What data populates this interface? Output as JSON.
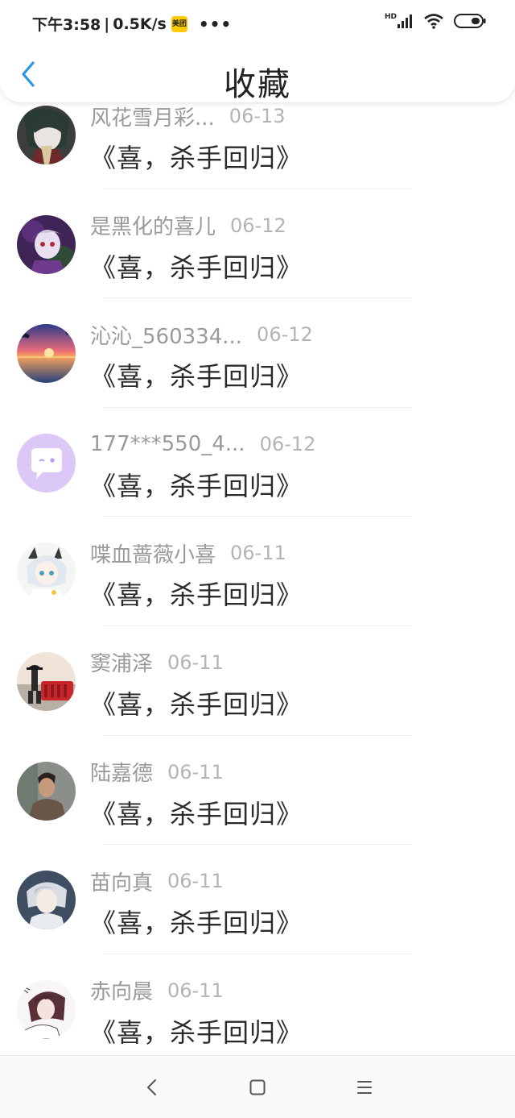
{
  "status_bar": {
    "time": "下午3:58",
    "separator": "|",
    "net_speed": "0.5K/s",
    "app_badge": "美团",
    "more_dots": "•••",
    "signal_label": "HD",
    "icons": [
      "meituan-icon",
      "hd-signal-icon",
      "wifi-icon",
      "battery-icon"
    ]
  },
  "header": {
    "title": "收藏",
    "back_icon": "chevron-left-icon",
    "accent_color": "#2d95e8"
  },
  "items": [
    {
      "name": "风花雪月彩...",
      "date": "06-13",
      "title": "《喜，杀手回归》",
      "avatar_icon": "anime-avatar-dark-icon"
    },
    {
      "name": "是黑化的喜儿",
      "date": "06-12",
      "title": "《喜，杀手回归》",
      "avatar_icon": "anime-avatar-purple-icon"
    },
    {
      "name": "沁沁_560334...",
      "date": "06-12",
      "title": "《喜，杀手回归》",
      "avatar_icon": "sunset-avatar-icon"
    },
    {
      "name": "177***550_4...",
      "date": "06-12",
      "title": "《喜，杀手回归》",
      "avatar_icon": "default-chat-avatar-icon"
    },
    {
      "name": "喋血蔷薇小喜",
      "date": "06-11",
      "title": "《喜，杀手回归》",
      "avatar_icon": "anime-avatar-white-icon"
    },
    {
      "name": "窦浦泽",
      "date": "06-11",
      "title": "《喜，杀手回归》",
      "avatar_icon": "photo-avatar-red-icon"
    },
    {
      "name": "陆嘉德",
      "date": "06-11",
      "title": "《喜，杀手回归》",
      "avatar_icon": "photo-avatar-man-icon"
    },
    {
      "name": "苗向真",
      "date": "06-11",
      "title": "《喜，杀手回归》",
      "avatar_icon": "anime-avatar-grey-icon"
    },
    {
      "name": "赤向晨",
      "date": "06-11",
      "title": "《喜，杀手回归》",
      "avatar_icon": "anime-avatar-sketch-icon"
    }
  ],
  "bottom_nav": {
    "icons": [
      "back-nav-icon",
      "home-nav-icon",
      "menu-nav-icon"
    ]
  }
}
